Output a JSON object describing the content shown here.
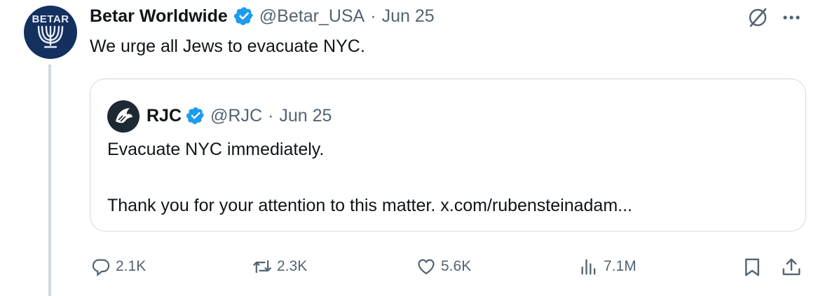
{
  "author": {
    "avatar_text": "BETAR",
    "name": "Betar Worldwide",
    "handle": "@Betar_USA",
    "separator": "·",
    "date": "Jun 25"
  },
  "tweet": {
    "text": "We urge all Jews to evacuate NYC."
  },
  "quoted": {
    "name": "RJC",
    "handle": "@RJC",
    "separator": "·",
    "date": "Jun 25",
    "line1": "Evacuate NYC immediately.",
    "line2": "Thank you for your attention to this matter. x.com/rubensteinadam..."
  },
  "actions": {
    "replies": "2.1K",
    "reposts": "2.3K",
    "likes": "5.6K",
    "views": "7.1M"
  },
  "colors": {
    "verified": "#1d9bf0",
    "muted": "#536471",
    "border": "#cfd9de",
    "avatar_bg": "#13305f"
  },
  "icons": [
    "grok-icon",
    "more-icon",
    "reply-icon",
    "repost-icon",
    "like-icon",
    "views-icon",
    "bookmark-icon",
    "share-icon"
  ]
}
